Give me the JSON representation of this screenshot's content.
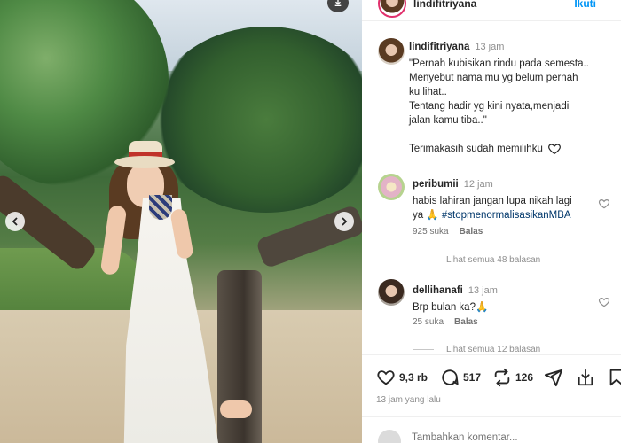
{
  "header": {
    "username": "lindifitriyana",
    "follow_label": "Ikuti"
  },
  "caption": {
    "username": "lindifitriyana",
    "time": "13 jam",
    "lines": [
      "\"Pernah kubisikan rindu pada semesta..",
      "Menyebut nama mu yg belum pernah",
      "ku lihat..",
      "Tentang hadir yg kini nyata,menjadi",
      "jalan kamu tiba..\""
    ],
    "thanks": "Terimakasih sudah memilihku"
  },
  "comments": [
    {
      "username": "peribumii",
      "time": "12 jam",
      "text_line1": "habis lahiran jangan lupa nikah lagi",
      "text_line2_pre": "ya ",
      "hashtag": "#stopmenormalisasikanMBA",
      "likes": "925 suka",
      "reply": "Balas",
      "view_replies": "Lihat semua 48 balasan"
    },
    {
      "username": "dellihanafi",
      "time": "13 jam",
      "text": "Brp bulan ka?",
      "likes": "25 suka",
      "reply": "Balas",
      "view_replies": "Lihat semua 12 balasan"
    }
  ],
  "actions": {
    "likes": "9,3 rb",
    "comments": "517",
    "reposts": "126"
  },
  "post_time": "13 jam yang lalu",
  "add_comment": {
    "placeholder": "Tambahkan komentar..."
  },
  "icons": {
    "heart": "heart-icon",
    "comment": "comment-icon",
    "repost": "repost-icon",
    "share": "share-icon",
    "save": "save-icon"
  }
}
